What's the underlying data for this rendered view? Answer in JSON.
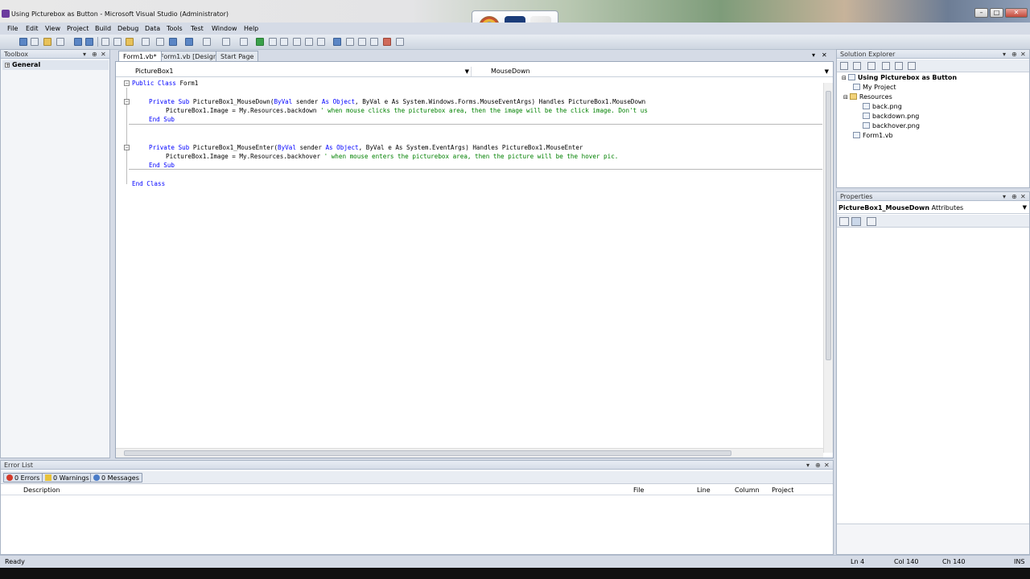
{
  "window": {
    "title": "Using Picturebox as Button - Microsoft Visual Studio (Administrator)",
    "controls": {
      "minimize": "–",
      "maximize": "□",
      "close": "✕"
    }
  },
  "taskswitch": {
    "icons": [
      "chrome-icon",
      "photoshop-icon",
      "visual-studio-icon"
    ],
    "ps_label": "Ps"
  },
  "menu": [
    "File",
    "Edit",
    "View",
    "Project",
    "Build",
    "Debug",
    "Data",
    "Tools",
    "Test",
    "Window",
    "Help"
  ],
  "toolbox": {
    "title": "Toolbox",
    "group": "General",
    "pin": "⊕",
    "dropdown": "▾",
    "close": "✕"
  },
  "tabs": [
    {
      "label": "Form1.vb*"
    },
    {
      "label": "Form1.vb [Design]*"
    },
    {
      "label": "Start Page"
    }
  ],
  "tabctl": {
    "dropdown": "▾",
    "close": "✕"
  },
  "editor": {
    "object_dropdown": "PictureBox1",
    "event_dropdown": "MouseDown",
    "lines": [
      {
        "k1": "Public Class",
        "t1": " Form1",
        "k2": "",
        "t2": "",
        "k3": "",
        "t3": "",
        "c": ""
      },
      {
        "k1": "Private Sub",
        "t1": " PictureBox1_MouseDown(",
        "k2": "ByVal",
        "t2": " sender ",
        "k3": "As Object",
        "t3": ", ByVal e As System.Windows.Forms.MouseEventArgs) Handles PictureBox1.MouseDown",
        "c": ""
      },
      {
        "k1": "",
        "t1": "PictureBox1.Image = My.Resources.backdown ",
        "k2": "",
        "t2": "",
        "k3": "",
        "t3": "",
        "c": "' when mouse clicks the picturebox area, then the image will be the click image. Don't us"
      },
      {
        "k1": "End Sub",
        "t1": "",
        "k2": "",
        "t2": "",
        "k3": "",
        "t3": "",
        "c": ""
      },
      {
        "k1": "Private Sub",
        "t1": " PictureBox1_MouseEnter(",
        "k2": "ByVal",
        "t2": " sender ",
        "k3": "As Object",
        "t3": ", ByVal e As System.EventArgs) Handles PictureBox1.MouseEnter",
        "c": ""
      },
      {
        "k1": "",
        "t1": "PictureBox1.Image = My.Resources.backhover ",
        "k2": "",
        "t2": "",
        "k3": "",
        "t3": "",
        "c": "' when mouse enters the picturebox area, then the picture will be the hover pic."
      },
      {
        "k1": "End Sub",
        "t1": "",
        "k2": "",
        "t2": "",
        "k3": "",
        "t3": "",
        "c": ""
      },
      {
        "k1": "End Class",
        "t1": "",
        "k2": "",
        "t2": "",
        "k3": "",
        "t3": "",
        "c": ""
      }
    ]
  },
  "solution_explorer": {
    "title": "Solution Explorer",
    "items": [
      {
        "label": "Using Picturebox as Button",
        "bold": true
      },
      {
        "label": "My Project"
      },
      {
        "label": "Resources"
      },
      {
        "label": "back.png"
      },
      {
        "label": "backdown.png"
      },
      {
        "label": "backhover.png"
      },
      {
        "label": "Form1.vb"
      }
    ]
  },
  "properties": {
    "title": "Properties",
    "object": "PictureBox1_MouseDown",
    "object_type": "Attributes"
  },
  "error_list": {
    "title": "Error List",
    "tabs": [
      "0 Errors",
      "0 Warnings",
      "0 Messages"
    ],
    "columns": [
      "Description",
      "File",
      "Line",
      "Column",
      "Project"
    ]
  },
  "status": {
    "text": "Ready",
    "ln": "Ln 4",
    "col": "Col 140",
    "ch": "Ch 140",
    "mode": "INS"
  }
}
